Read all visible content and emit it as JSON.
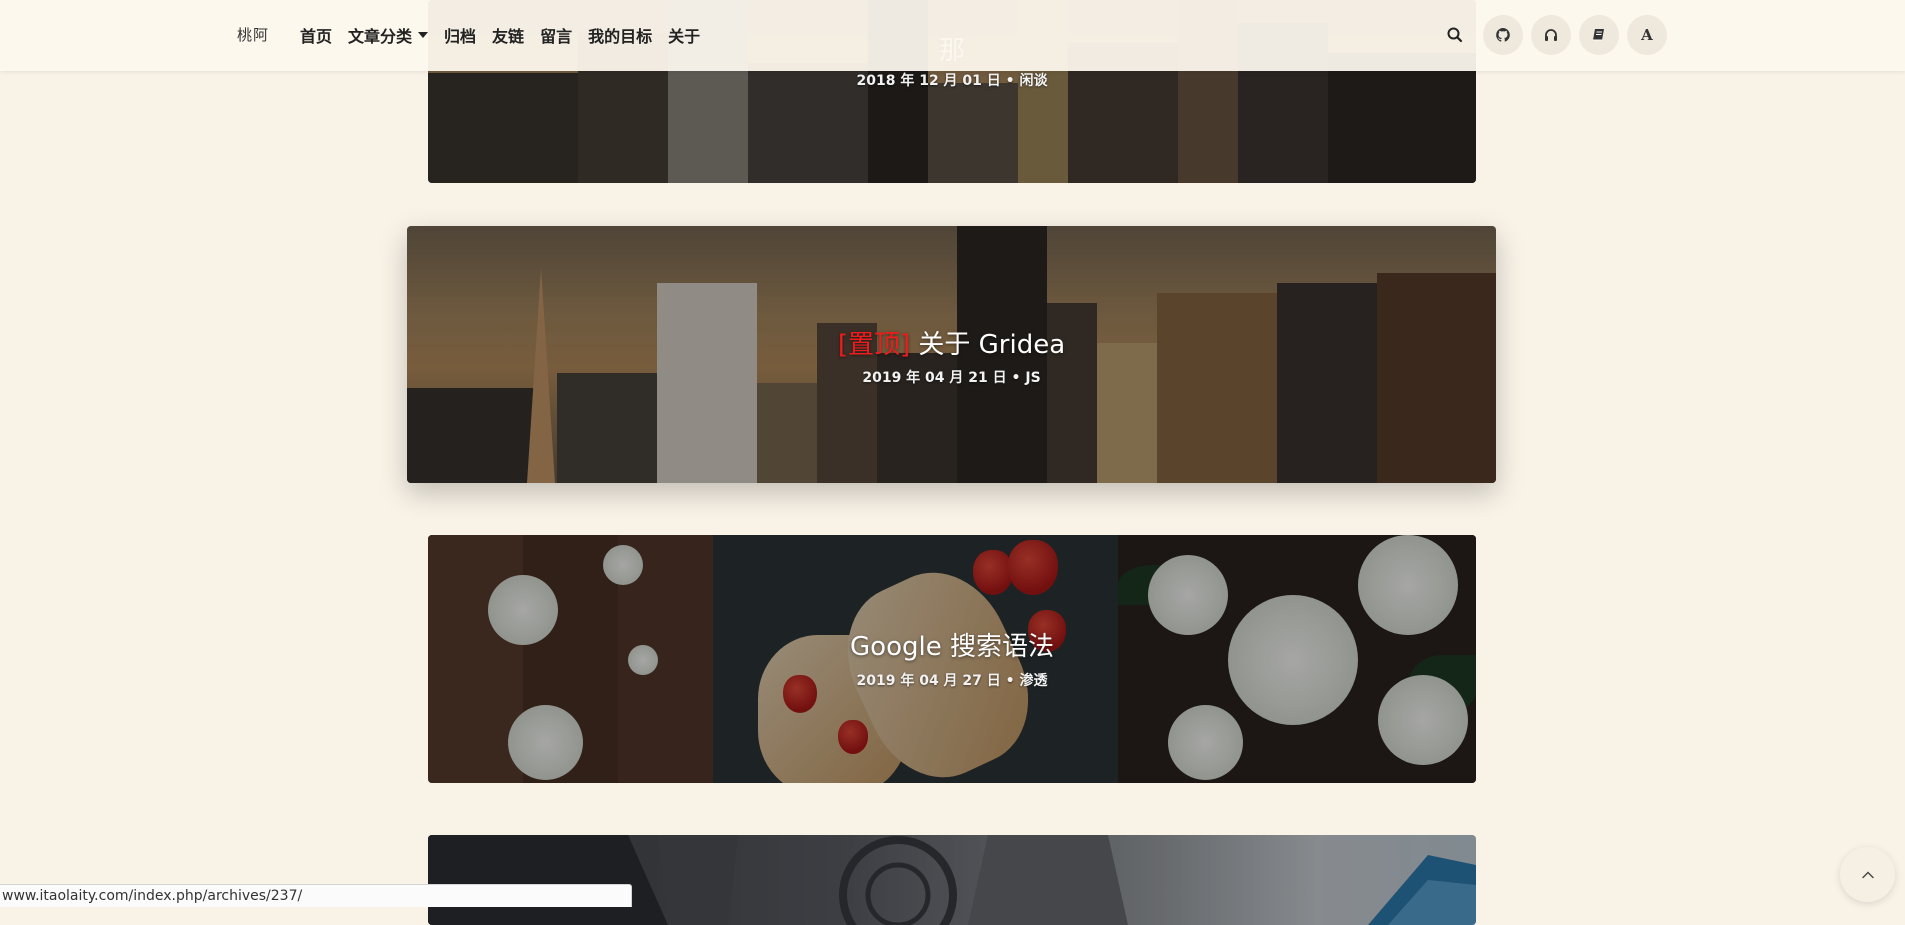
{
  "site": {
    "logo": "桃阿"
  },
  "nav": {
    "items": [
      {
        "label": "首页"
      },
      {
        "label": "文章分类",
        "has_dropdown": true
      },
      {
        "label": "归档"
      },
      {
        "label": "友链"
      },
      {
        "label": "留言"
      },
      {
        "label": "我的目标"
      },
      {
        "label": "关于"
      }
    ]
  },
  "toolbar": {
    "buttons": [
      {
        "icon": "search-icon"
      },
      {
        "icon": "github-icon"
      },
      {
        "icon": "headphones-icon"
      },
      {
        "icon": "book-icon"
      },
      {
        "icon": "font-size-icon",
        "label": "A"
      }
    ]
  },
  "posts": [
    {
      "title": "那",
      "date": "2018 年 12 月 01 日",
      "sep": "•",
      "category": "闲谈",
      "image": "city-skyline"
    },
    {
      "pin_label": "[置顶]",
      "title": "关于 Gridea",
      "date": "2019 年 04 月 21 日",
      "sep": "•",
      "category": "JS",
      "image": "city-skyline"
    },
    {
      "title": "Google 搜索语法",
      "date": "2019 年 04 月 27 日",
      "sep": "•",
      "category": "渗透",
      "image": "strawberries-flowers"
    },
    {
      "title": "",
      "image": "cathedral"
    }
  ],
  "colors": {
    "background": "#f8f2e7",
    "header": "#fdf8ee",
    "pin": "#ee1c1c"
  },
  "status_bar": {
    "url": "www.itaolaity.com/index.php/archives/237/"
  },
  "back_to_top": {
    "icon": "chevron-up-icon"
  }
}
